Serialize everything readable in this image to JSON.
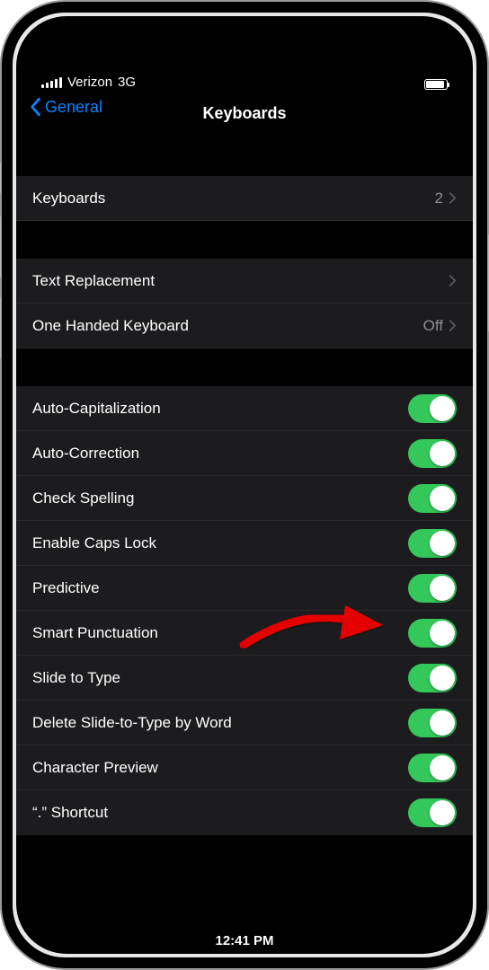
{
  "status": {
    "carrier": "Verizon",
    "network": "3G",
    "time": "12:41 PM"
  },
  "nav": {
    "back_label": "General",
    "title": "Keyboards"
  },
  "group1": {
    "keyboards": {
      "label": "Keyboards",
      "value": "2"
    }
  },
  "group2": {
    "text_replacement": {
      "label": "Text Replacement"
    },
    "one_handed": {
      "label": "One Handed Keyboard",
      "value": "Off"
    }
  },
  "toggles": {
    "auto_cap": {
      "label": "Auto-Capitalization",
      "on": true
    },
    "auto_corr": {
      "label": "Auto-Correction",
      "on": true
    },
    "check_spell": {
      "label": "Check Spelling",
      "on": true
    },
    "caps_lock": {
      "label": "Enable Caps Lock",
      "on": true
    },
    "predictive": {
      "label": "Predictive",
      "on": true
    },
    "smart_punct": {
      "label": "Smart Punctuation",
      "on": true
    },
    "slide_type": {
      "label": "Slide to Type",
      "on": true
    },
    "del_slide": {
      "label": "Delete Slide-to-Type by Word",
      "on": true
    },
    "char_prev": {
      "label": "Character Preview",
      "on": true
    },
    "period_shortcut": {
      "label": "“.” Shortcut",
      "on": true
    }
  },
  "annotation": {
    "target": "predictive"
  }
}
